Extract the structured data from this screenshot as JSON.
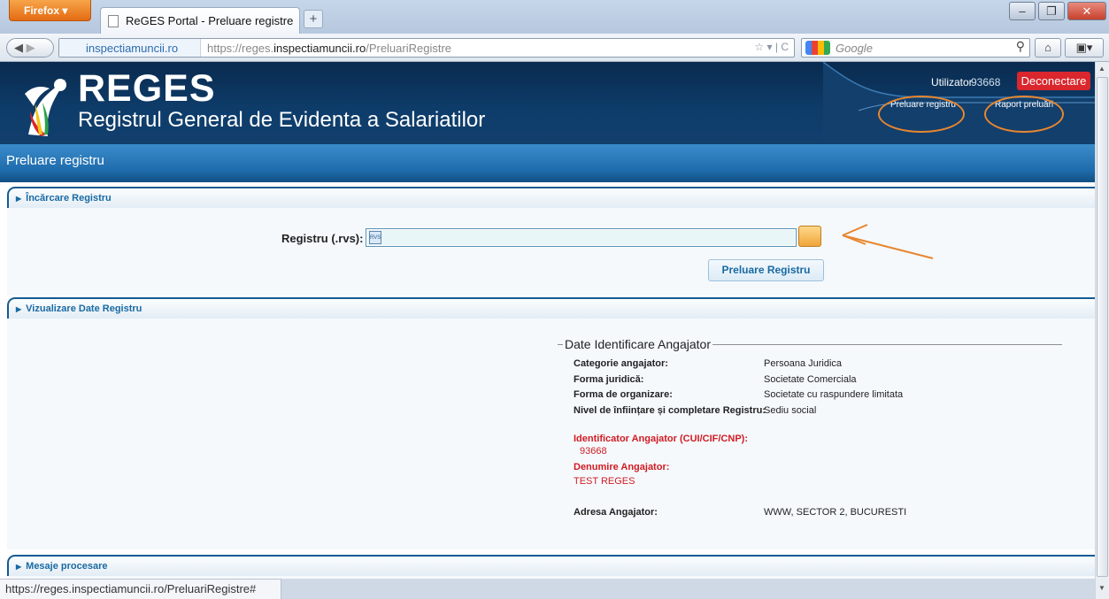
{
  "browser": {
    "firefox_button": "Firefox",
    "tab_title": "ReGES Portal - Preluare registre",
    "new_tab": "+",
    "identity_domain": "inspectiamuncii.ro",
    "url_prefix": "https://reges.",
    "url_domain": "inspectiamuncii.ro",
    "url_path": "/PreluariRegistre",
    "search_placeholder": "Google",
    "status_url": "https://reges.inspectiamuncii.ro/PreluariRegistre#"
  },
  "header": {
    "brand": "REGES",
    "subtitle": "Registrul General de Evidenta a Salariatilor",
    "user_label": "Utilizator",
    "user_id": "93668",
    "logout": "Deconectare",
    "nav": [
      {
        "label": "Preluare registru"
      },
      {
        "label": "Raport preluări"
      }
    ]
  },
  "page_title": "Preluare registru",
  "sections": {
    "upload": {
      "title": "Încărcare Registru",
      "field_label": "Registru (.rvs):",
      "file_icon_text": "RVS",
      "submit_label": "Preluare Registru"
    },
    "view": {
      "title": "Vizualizare Date Registru"
    },
    "messages": {
      "title": "Mesaje procesare"
    }
  },
  "employer": {
    "legend": "Date Identificare Angajator",
    "rows": [
      {
        "label": "Categorie angajator:",
        "value": "Persoana Juridica"
      },
      {
        "label": "Forma juridică:",
        "value": "Societate Comerciala"
      },
      {
        "label": "Forma de organizare:",
        "value": "Societate cu raspundere limitata"
      },
      {
        "label": "Nivel de înființare și completare Registru:",
        "value": "Sediu social"
      }
    ],
    "id_label": "Identificator Angajator (CUI/CIF/CNP):",
    "id_value": "93668",
    "name_label": "Denumire Angajator:",
    "name_value": "TEST REGES",
    "address_label": "Adresa Angajator:",
    "address_value": "WWW, SECTOR 2, BUCURESTI"
  },
  "colors": {
    "header_dark": "#0e3d6b",
    "accent_blue": "#196aa3",
    "logout_red": "#d9272d",
    "annotation_orange": "#e8862f",
    "highlight_red": "#d01b22"
  }
}
